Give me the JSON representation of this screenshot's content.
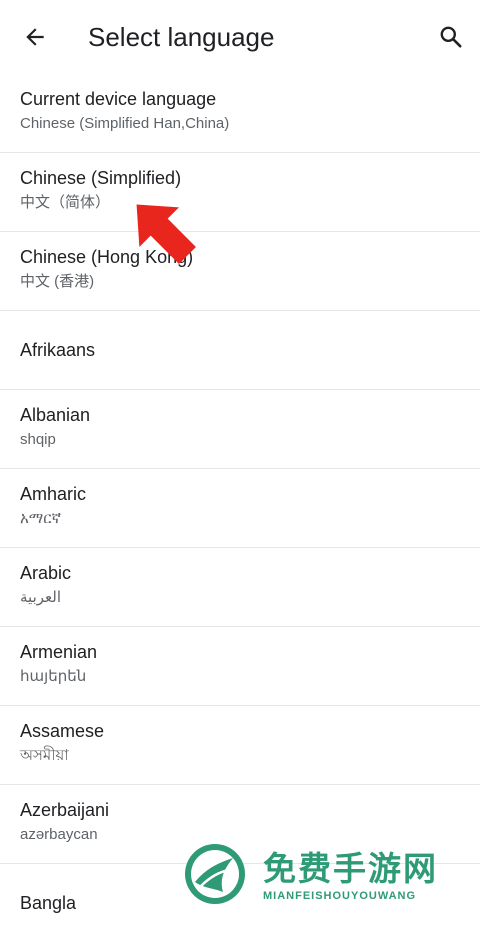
{
  "appbar": {
    "title": "Select language",
    "back_icon": "arrow-back-icon",
    "search_icon": "search-icon"
  },
  "languages": [
    {
      "name": "Current device language",
      "native": "Chinese (Simplified Han,China)"
    },
    {
      "name": "Chinese (Simplified)",
      "native": "中文（简体）"
    },
    {
      "name": "Chinese (Hong Kong)",
      "native": "中文 (香港)"
    },
    {
      "name": "Afrikaans",
      "native": ""
    },
    {
      "name": "Albanian",
      "native": "shqip"
    },
    {
      "name": "Amharic",
      "native": "አማርኛ"
    },
    {
      "name": "Arabic",
      "native": "العربية"
    },
    {
      "name": "Armenian",
      "native": "հայերեն"
    },
    {
      "name": "Assamese",
      "native": "অসমীয়া"
    },
    {
      "name": "Azerbaijani",
      "native": "azərbaycan"
    },
    {
      "name": "Bangla",
      "native": ""
    }
  ],
  "annotation": {
    "arrow_color": "#e8261e",
    "arrow_icon": "red-pointer-arrow-icon"
  },
  "watermark": {
    "title": "免费手游网",
    "subtitle": "MIANFEISHOUYOUWANG",
    "color": "#2e9a76"
  }
}
